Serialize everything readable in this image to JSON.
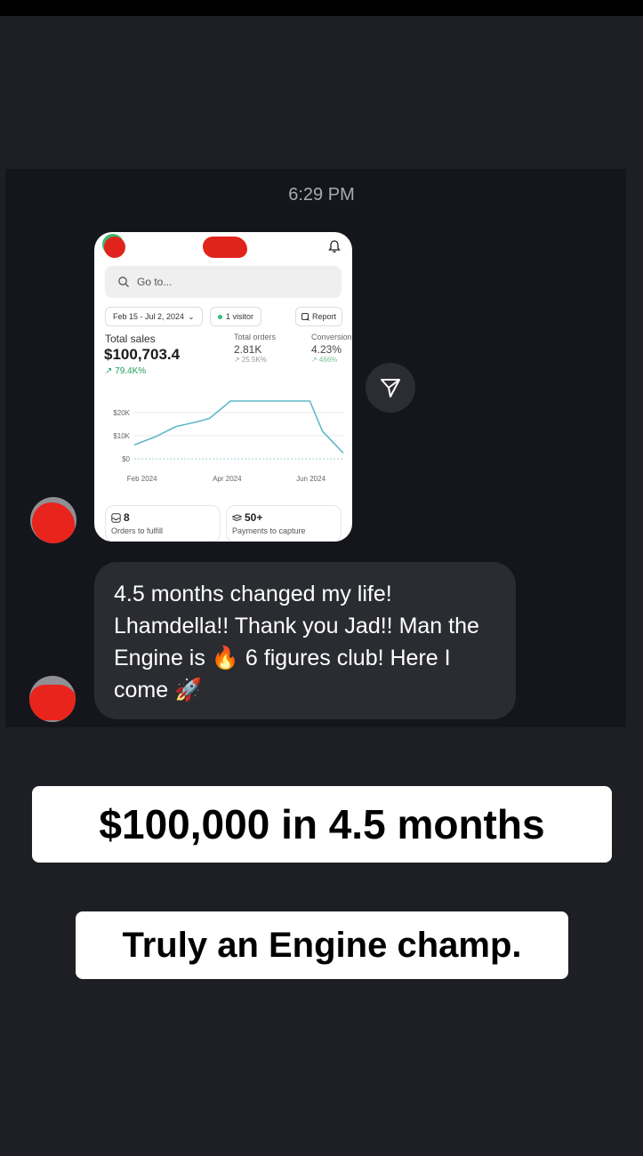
{
  "timestamp": "6:29 PM",
  "dashboard": {
    "search_placeholder": "Go to...",
    "date_range": "Feb 15 - Jul 2, 2024",
    "visitors": "1 visitor",
    "report_label": "Report",
    "total_sales_label": "Total sales",
    "total_sales_value": "$100,703.4",
    "total_sales_change": "↗ 79.4K%",
    "total_orders_label": "Total orders",
    "total_orders_value": "2.81K",
    "total_orders_change": "↗ 25.5K%",
    "conversion_label": "Conversion",
    "conversion_value": "4.23%",
    "conversion_change": "↗ 466%",
    "tiles": [
      {
        "number": "8",
        "label": "Orders to fulfill",
        "icon": "inbox-icon"
      },
      {
        "number": "50+",
        "label": "Payments to capture",
        "icon": "payment-icon"
      }
    ]
  },
  "chart_data": {
    "type": "line",
    "yticks": [
      "$20K",
      "$10K",
      "$0"
    ],
    "xticks": [
      "Feb 2024",
      "Apr 2024",
      "Jun 2024"
    ],
    "ylim": [
      0,
      25000
    ],
    "x": [
      0,
      0.1,
      0.2,
      0.3,
      0.36,
      0.46,
      0.56,
      0.66,
      0.76,
      0.84,
      0.9,
      1.0
    ],
    "values": [
      6000,
      9500,
      14000,
      16000,
      17500,
      25000,
      25000,
      25000,
      25000,
      25000,
      12000,
      2500
    ],
    "line_color": "#5fb8c9",
    "grid": true
  },
  "message": {
    "line1_text": "4.5 months changed my life! Lhamdella!! Thank you Jad!! Man the Engine is",
    "emoji_fire": "🔥",
    "line2_text": "6 figures club! Here I come",
    "emoji_rocket": "🚀"
  },
  "captions": {
    "headline": "$100,000 in 4.5 months",
    "subline": "Truly an Engine champ."
  },
  "colors": {
    "background": "#1e1f25",
    "bubble": "#2a2c31",
    "redaction": "#e0241c",
    "accent_green": "#1f9e5d"
  },
  "icons": {
    "share": "send-icon",
    "bell": "bell-icon",
    "search": "search-icon"
  }
}
